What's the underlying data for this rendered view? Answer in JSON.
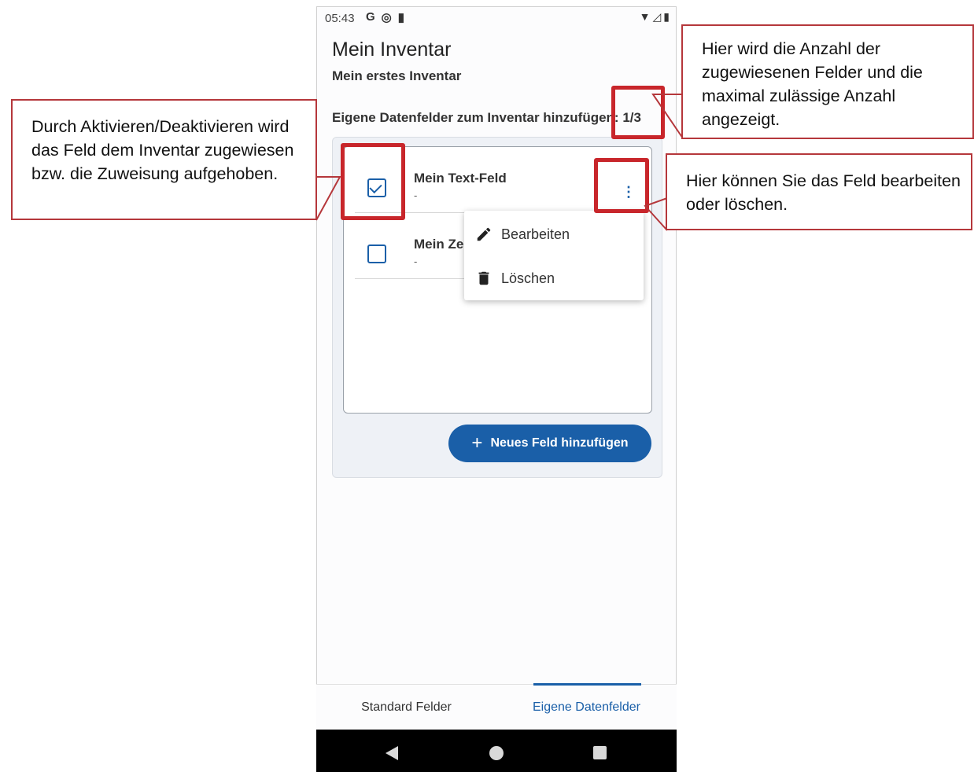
{
  "status": {
    "time": "05:43",
    "left_icons": [
      "G",
      "◎",
      "▮"
    ],
    "right_icons": [
      "▼",
      "◿",
      "▮"
    ]
  },
  "header": {
    "title": "Mein Inventar",
    "subtitle": "Mein erstes Inventar"
  },
  "section": {
    "label": "Eigene Datenfelder zum Inventar hinzufügen: 1/3",
    "counter": "1/3"
  },
  "fields": [
    {
      "name": "Mein Text-Feld",
      "value": "-",
      "checked": true
    },
    {
      "name": "Mein Ze",
      "value": "-",
      "checked": false
    }
  ],
  "menu": {
    "items": [
      {
        "label": "Bearbeiten",
        "icon": "pencil-icon"
      },
      {
        "label": "Löschen",
        "icon": "trash-icon"
      }
    ]
  },
  "add_button": {
    "plus": "+",
    "label": "Neues Feld hinzufügen"
  },
  "tabs": [
    {
      "label": "Standard Felder",
      "active": false
    },
    {
      "label": "Eigene Datenfelder",
      "active": true
    }
  ],
  "callouts": {
    "left": "Durch Aktivieren/Deaktivieren wird das Feld dem Inventar zugewiesen bzw. die Zuweisung aufgehoben.",
    "top_right": "Hier wird die Anzahl der zugewiesenen Felder und die maximal zulässige Anzahl angezeigt.",
    "mid_right": "Hier können Sie das Feld bearbeiten oder löschen."
  },
  "colors": {
    "accent": "#1a5fa8",
    "highlight": "#c8262b",
    "callout_border": "#b5373b"
  }
}
